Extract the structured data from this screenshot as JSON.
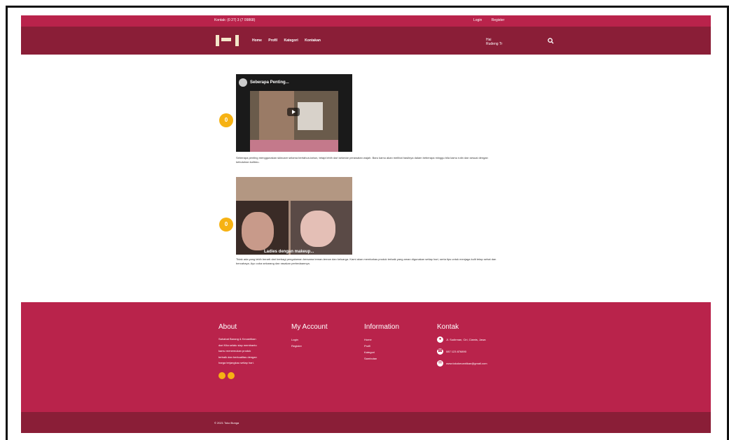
{
  "topbar": {
    "contact": "Kontak: (0 27) 3 (7 09868)",
    "login": "Login",
    "register": "Register"
  },
  "nav": {
    "items": [
      "Home",
      "Profil",
      "Kategori",
      "Kontakan"
    ],
    "account": [
      "Hai",
      "Rudeng Tr"
    ]
  },
  "posts": [
    {
      "badge": "0",
      "video_title": "Seberapa Penting...",
      "desc": "Seberapa penting menggunakan skincare selama bertahun-tahun, tetapi lebih dari sekedar perawatan wajah. Baru kamu akan melihat hasilnya dalam beberapa minggu bila kamu rutin dan sesuai dengan kebutuhan kulitmu."
    },
    {
      "badge": "0",
      "photo_caption": "Ladies dengan makeup...",
      "desc": "Tidak ada yang lebih berarti dari berbagi pengalaman bersama teman-teman dan keluarga. Kami akan membahas produk terbaik yang aman digunakan setiap hari, serta tips untuk menjaga kulit tetap sehat dan bercahaya. Ayo coba sekarang dan rasakan perbedaannya."
    }
  ],
  "footer": {
    "about_title": "About",
    "about_text": "Sahabat Barang & Kecantikan dari Kita selalu siap membantu kamu menemukan produk terbaik dan berkualitas dengan harga terjangkau setiap hari.",
    "account_title": "My Account",
    "account_items": [
      "Login",
      "Register"
    ],
    "info_title": "Information",
    "info_items": [
      "Home",
      "Profil",
      "Kategori",
      "Sambutan"
    ],
    "contact_title": "Kontak",
    "contact_items": [
      "Jl. Sudirman, Ciri, Ciamis, Jawa",
      "087 123 876890",
      "www.tokokecantikan@gmail.com"
    ]
  },
  "copyright": "© 2021 Toko Bunga",
  "colors": {
    "primary": "#b9234b",
    "dark": "#8a1e37",
    "accent": "#f6b213"
  }
}
